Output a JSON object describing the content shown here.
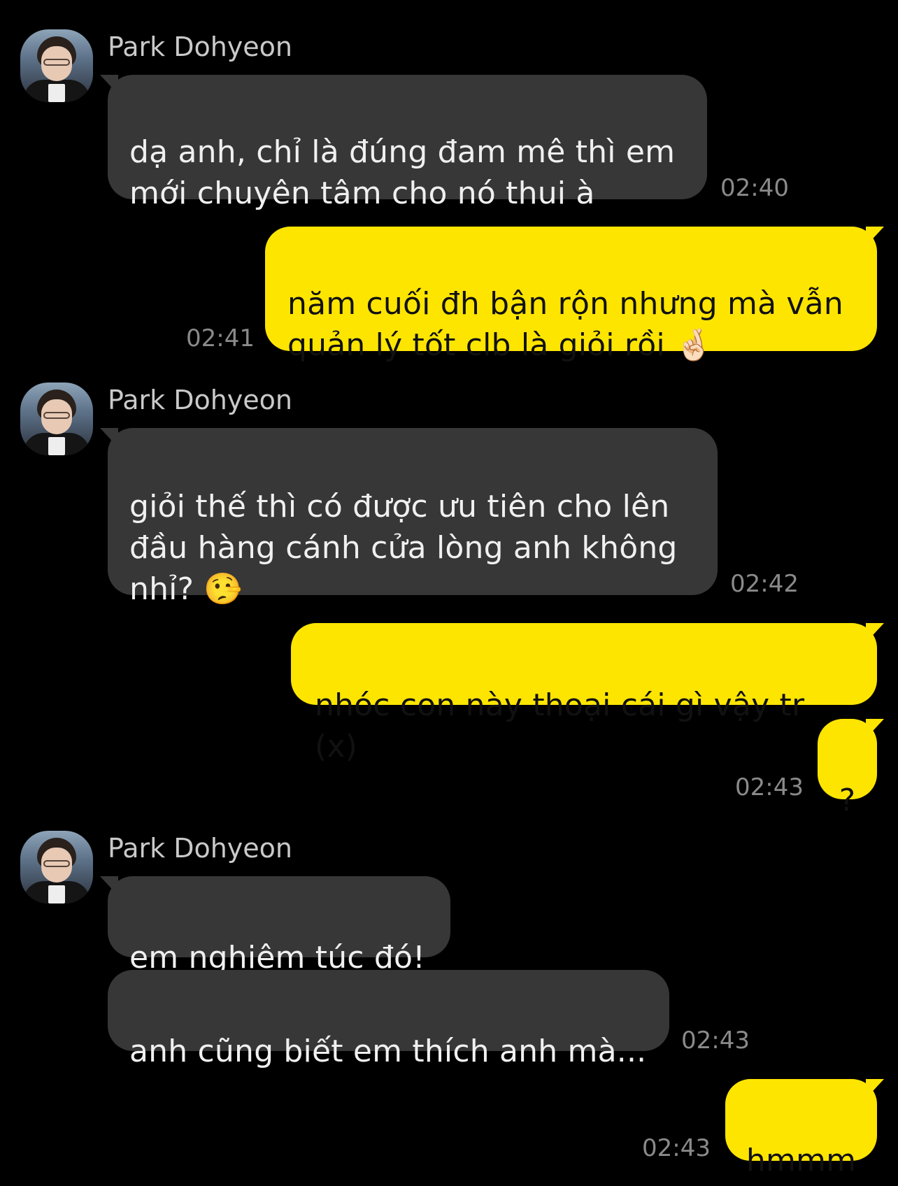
{
  "sender_name": "Park Dohyeon",
  "messages": {
    "m1": {
      "text": "dạ anh, chỉ là đúng đam mê thì em\nmới chuyên tâm cho nó thui à",
      "time": "02:40"
    },
    "m2": {
      "text": "năm cuối đh bận rộn nhưng mà vẫn\nquản lý tốt clb là giỏi rồi 🤞🏻",
      "time": "02:41"
    },
    "m3": {
      "text": "giỏi thế thì có được ưu tiên cho lên\nđầu hàng cánh cửa lòng anh không\nnhỉ? 🤥",
      "time": "02:42"
    },
    "m4": {
      "text": "nhóc con này thoại cái gì vậy tr (x)"
    },
    "m5": {
      "text": "?",
      "time": "02:43"
    },
    "m6": {
      "text": "em nghiêm túc đó!"
    },
    "m7": {
      "text": "anh cũng biết em thích anh mà...",
      "time": "02:43"
    },
    "m8": {
      "text": "hmmm",
      "time": "02:43"
    }
  },
  "colors": {
    "background": "#000000",
    "incoming_bubble": "#373737",
    "outgoing_bubble": "#fee500",
    "timestamp": "#8a8a8a"
  }
}
